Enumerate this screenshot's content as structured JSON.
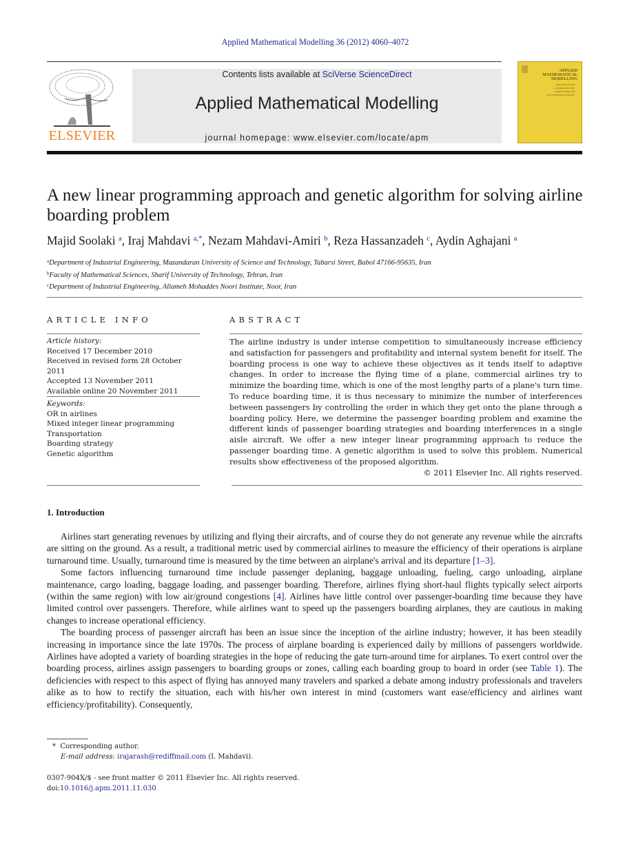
{
  "header": {
    "journal_reference": "Applied Mathematical Modelling 36 (2012) 4060–4072",
    "contents_prefix": "Contents lists available at ",
    "contents_link": "SciVerse ScienceDirect",
    "journal_title": "Applied Mathematical Modelling",
    "homepage_prefix": "journal homepage: ",
    "homepage_url": "www.elsevier.com/locate/apm",
    "publisher_logo_text": "ELSEVIER",
    "cover_title": "APPLIED MATHEMATICAL MODELLING",
    "cover_subtitle": "Simulation and computation for engineering and environmental systems"
  },
  "article": {
    "title": "A new linear programming approach and genetic algorithm for solving airline boarding problem",
    "authors": [
      {
        "name": "Majid Soolaki",
        "sup": "a"
      },
      {
        "name": "Iraj Mahdavi",
        "sup": "a,*"
      },
      {
        "name": "Nezam Mahdavi-Amiri",
        "sup": "b"
      },
      {
        "name": "Reza Hassanzadeh",
        "sup": "c"
      },
      {
        "name": "Aydin Aghajani",
        "sup": "a"
      }
    ],
    "affiliations": [
      {
        "mark": "a",
        "text": "Department of Industrial Engineering, Mazandaran University of Science and Technology, Tabarsi Street, Babol 47166-95635, Iran"
      },
      {
        "mark": "b",
        "text": "Faculty of Mathematical Sciences, Sharif University of Technology, Tehran, Iran"
      },
      {
        "mark": "c",
        "text": "Department of Industrial Engineering, Allameh Mohaddes Noori Institute, Noor, Iran"
      }
    ]
  },
  "article_info": {
    "heading": "ARTICLE INFO",
    "history_label": "Article history:",
    "history": [
      "Received 17 December 2010",
      "Received in revised form 28 October 2011",
      "Accepted 13 November 2011",
      "Available online 20 November 2011"
    ],
    "keywords_label": "Keywords:",
    "keywords": [
      "OR in airlines",
      "Mixed integer linear programming",
      "Transportation",
      "Boarding strategy",
      "Genetic algorithm"
    ]
  },
  "abstract": {
    "heading": "ABSTRACT",
    "text": "The airline industry is under intense competition to simultaneously increase efficiency and satisfaction for passengers and profitability and internal system benefit for itself. The boarding process is one way to achieve these objectives as it tends itself to adaptive changes. In order to increase the flying time of a plane, commercial airlines try to minimize the boarding time, which is one of the most lengthy parts of a plane's turn time. To reduce boarding time, it is thus necessary to minimize the number of interferences between passengers by controlling the order in which they get onto the plane through a boarding policy. Here, we determine the passenger boarding problem and examine the different kinds of passenger boarding strategies and boarding interferences in a single aisle aircraft. We offer a new integer linear programming approach to reduce the passenger boarding time. A genetic algorithm is used to solve this problem. Numerical results show effectiveness of the proposed algorithm.",
    "copyright": "© 2011 Elsevier Inc. All rights reserved."
  },
  "introduction": {
    "heading": "1. Introduction",
    "p1_a": "Airlines start generating revenues by utilizing and flying their aircrafts, and of course they do not generate any revenue while the aircrafts are sitting on the ground. As a result, a traditional metric used by commercial airlines to measure the efficiency of their operations is airplane turnaround time. Usually, turnaround time is measured by the time between an airplane's arrival and its departure ",
    "p1_ref": "[1–3]",
    "p1_b": ".",
    "p2_a": "Some factors influencing turnaround time include passenger deplaning, baggage unloading, fueling, cargo unloading, airplane maintenance, cargo loading, baggage loading, and passenger boarding. Therefore, airlines flying short-haul flights typically select airports (within the same region) with low air/ground congestions ",
    "p2_ref": "[4]",
    "p2_b": ". Airlines have little control over passenger-boarding time because they have limited control over passengers. Therefore, while airlines want to speed up the passengers boarding airplanes, they are cautious in making changes to increase operational efficiency.",
    "p3_a": "The boarding process of passenger aircraft has been an issue since the inception of the airline industry; however, it has been steadily increasing in importance since the late 1970s. The process of airplane boarding is experienced daily by millions of passengers worldwide. Airlines have adopted a variety of boarding strategies in the hope of reducing the gate turn-around time for airplanes. To exert control over the boarding process, airlines assign passengers to boarding groups or zones, calling each boarding group to board in order (see ",
    "p3_ref": "Table 1",
    "p3_b": "). The deficiencies with respect to this aspect of flying has annoyed many travelers and sparked a debate among industry professionals and travelers alike as to how to rectify the situation, each with his/her own interest in mind (customers want ease/efficiency and airlines want efficiency/profitability). Consequently,"
  },
  "footnote": {
    "marker": "*",
    "corresponding": "Corresponding author.",
    "email_label": "E-mail address:",
    "email": "irajarash@rediffmail.com",
    "email_suffix": " (I. Mahdavi)."
  },
  "front_matter": {
    "issn_line": "0307-904X/$ - see front matter © 2011 Elsevier Inc. All rights reserved.",
    "doi_label": "doi:",
    "doi": "10.1016/j.apm.2011.11.030"
  }
}
